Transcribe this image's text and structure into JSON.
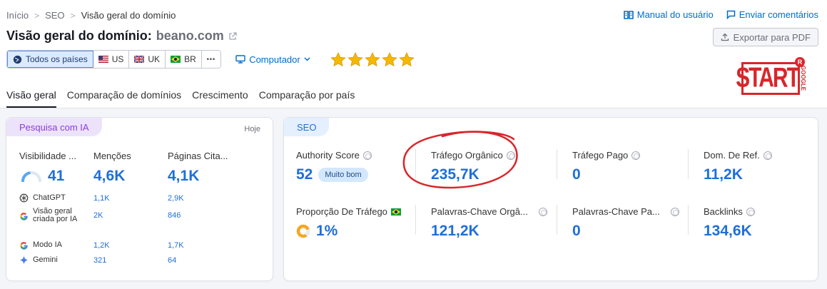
{
  "breadcrumb": [
    "Início",
    "SEO",
    "Visão geral do domínio"
  ],
  "top_links": {
    "manual": "Manual do usuário",
    "feedback": "Enviar comentários"
  },
  "title": {
    "text": "Visão geral do domínio:",
    "domain": "beano.com"
  },
  "export_label": "Exportar para PDF",
  "filters": {
    "all_countries": "Todos os países",
    "countries": [
      "US",
      "UK",
      "BR"
    ],
    "more": "•••",
    "device": "Computador"
  },
  "rating_stars": 5,
  "logo": {
    "main": "START",
    "vertical": "GOOGLE",
    "mark": "R"
  },
  "tabs": [
    "Visão geral",
    "Comparação de domínios",
    "Crescimento",
    "Comparação por país"
  ],
  "ai_card": {
    "pill": "Pesquisa com IA",
    "date": "Hoje",
    "cols": [
      {
        "label": "Visibilidade ...",
        "value": "41",
        "gauge": 0.41
      },
      {
        "label": "Menções",
        "value": "4,6K"
      },
      {
        "label": "Páginas Cita...",
        "value": "4,1K"
      }
    ],
    "rows": [
      {
        "name": "ChatGPT",
        "v1": "1,1K",
        "v2": "2,9K",
        "icon": "chatgpt-icon"
      },
      {
        "name": "Visão geral criada por IA",
        "v1": "2K",
        "v2": "846",
        "icon": "google-icon"
      },
      {
        "name": "Modo IA",
        "v1": "1,2K",
        "v2": "1,7K",
        "icon": "google-icon"
      },
      {
        "name": "Gemini",
        "v1": "321",
        "v2": "64",
        "icon": "gemini-icon"
      }
    ]
  },
  "seo_card": {
    "pill": "SEO",
    "authority": {
      "label": "Authority Score",
      "value": "52",
      "badge": "Muito bom"
    },
    "organic": {
      "label": "Tráfego Orgânico",
      "value": "235,7K"
    },
    "paid": {
      "label": "Tráfego Pago",
      "value": "0"
    },
    "refdomains": {
      "label": "Dom. De Ref.",
      "value": "11,2K"
    },
    "traffic_share": {
      "label": "Proporção De Tráfego",
      "value": "1%",
      "fraction": 0.01
    },
    "organic_kw": {
      "label": "Palavras-Chave Orgâ...",
      "value": "121,2K"
    },
    "paid_kw": {
      "label": "Palavras-Chave Pa...",
      "value": "0"
    },
    "backlinks": {
      "label": "Backlinks",
      "value": "134,6K"
    }
  },
  "colors": {
    "accent": "#1e6fd9",
    "link": "#006dca",
    "highlight_circle": "#d8262b",
    "star": "#f5b800"
  }
}
